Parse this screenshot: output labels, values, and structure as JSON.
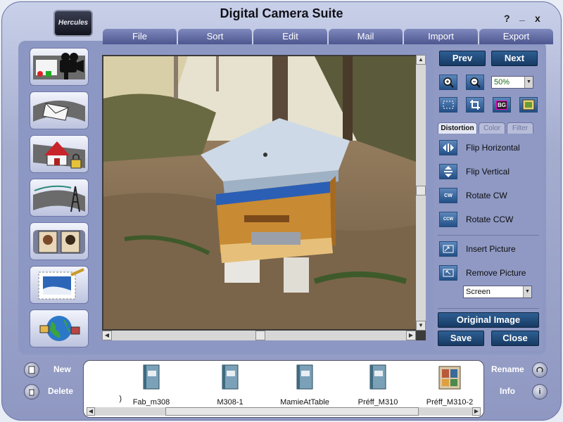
{
  "window": {
    "title": "Digital Camera Suite",
    "logo_text": "Hercules",
    "help": "?",
    "minimize": "_",
    "close": "x"
  },
  "menu": [
    "File",
    "Sort",
    "Edit",
    "Mail",
    "Import",
    "Export"
  ],
  "sidebar": {
    "items": [
      "video-camera-film-icon",
      "mail-film-icon",
      "home-lock-film-icon",
      "transmission-tower-film-icon",
      "photo-album-icon",
      "stamp-icon",
      "globe-photos-icon"
    ]
  },
  "viewer": {
    "image_subject": "beehive-photo"
  },
  "nav": {
    "prev": "Prev",
    "next": "Next"
  },
  "zoom": {
    "value": "50%"
  },
  "tools": [
    "zoom-in-icon",
    "zoom-out-icon",
    "select-icon",
    "crop-icon",
    "bg-icon",
    "picture-frame-icon"
  ],
  "tools_bg_label": "BG",
  "tabs": [
    {
      "label": "Distortion",
      "active": true
    },
    {
      "label": "Color",
      "active": false
    },
    {
      "label": "Filter",
      "active": false
    }
  ],
  "actions": {
    "flip_h": "Flip Horizontal",
    "flip_v": "Flip Vertical",
    "rotate_cw": "Rotate CW",
    "rotate_ccw": "Rotate CCW",
    "insert": "Insert Picture",
    "remove": "Remove Picture",
    "cw_icon_text": "CW",
    "ccw_icon_text": "CCW"
  },
  "screen_select": {
    "value": "Screen"
  },
  "bottom_buttons": {
    "original": "Original Image",
    "save": "Save",
    "close": "Close"
  },
  "left_buttons": {
    "new": "New",
    "delete": "Delete"
  },
  "right_buttons": {
    "rename": "Rename",
    "info": "Info"
  },
  "files": [
    {
      "name": ")",
      "type": "partial"
    },
    {
      "name": "Fab_m308",
      "type": "book"
    },
    {
      "name": "M308-1",
      "type": "book"
    },
    {
      "name": "MamieAtTable",
      "type": "book"
    },
    {
      "name": "Préff_M310",
      "type": "book"
    },
    {
      "name": "Préff_M310-2",
      "type": "book-open"
    }
  ]
}
